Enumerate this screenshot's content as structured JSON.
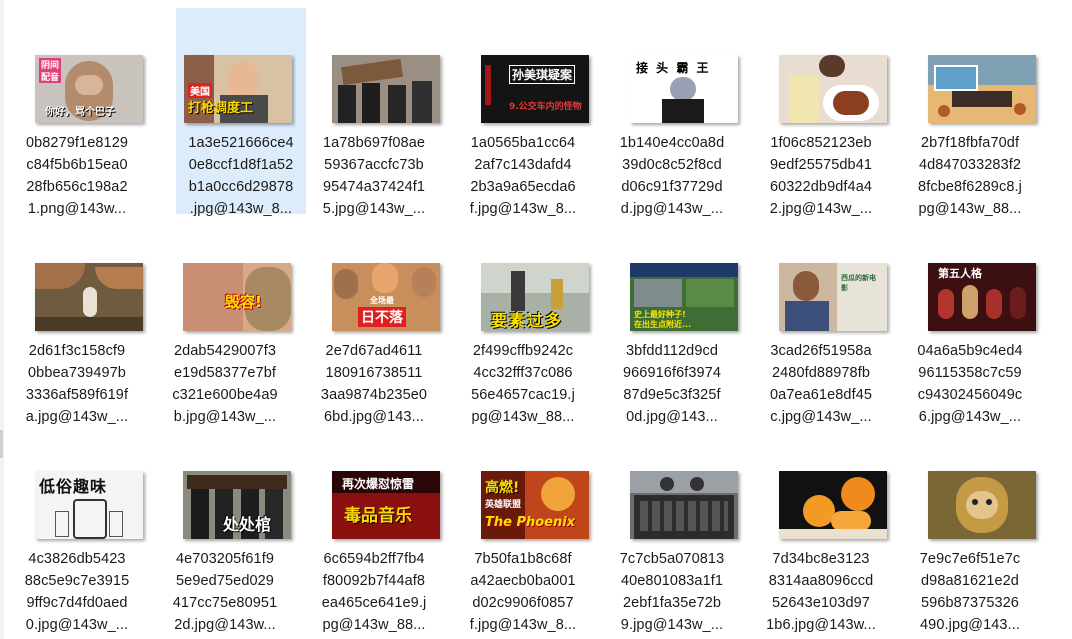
{
  "files": [
    {
      "name": "0b8279f1e8129c84f5b6b15ea028fb656c198a21.png@143w_...",
      "lines": [
        "0b8279f1e8129",
        "c84f5b6b15ea0",
        "28fb656c198a2",
        "1.png@143w..."
      ],
      "thumb_text": [
        "阴间",
        "配音",
        "你好，骂个巴子"
      ],
      "icon": "cat-doll-image",
      "selected": false
    },
    {
      "name": "1a3e521666ce40e8ccf1d8f1a52b1a0cc6d29878.jpg@143w_8...",
      "lines": [
        "1a3e521666ce4",
        "0e8ccf1d8f1a52",
        "b1a0cc6d29878",
        ".jpg@143w_8..."
      ],
      "thumb_text": [
        "美国",
        "打枪调度工"
      ],
      "icon": "man-portrait-image",
      "selected": true
    },
    {
      "name": "1a78b697f08ae59367accfc73b95474a37424f15.jpg@143w_...",
      "lines": [
        "1a78b697f08ae",
        "59367accfc73b",
        "95474a37424f1",
        "5.jpg@143w_..."
      ],
      "thumb_text": [],
      "icon": "coffin-dance-image",
      "selected": false
    },
    {
      "name": "1a0565ba1cc642af7c143dafd42b3a9a65ecda6f.jpg@143w_8...",
      "lines": [
        "1a0565ba1cc64",
        "2af7c143dafd4",
        "2b3a9a65ecda6",
        "f.jpg@143w_8..."
      ],
      "thumb_text": [
        "孙美琪疑案",
        "9.公交车内的怪物"
      ],
      "icon": "dark-title-image",
      "selected": false
    },
    {
      "name": "1b140e4cc0a8d39d0c8c52f8cdd06c91f37729dd.jpg@143w_...",
      "lines": [
        "1b140e4cc0a8d",
        "39d0c8c52f8cd",
        "d06c91f37729d",
        "d.jpg@143w_..."
      ],
      "thumb_text": [
        "接 头 霸 王"
      ],
      "icon": "cat-girl-image",
      "selected": false
    },
    {
      "name": "1f06c852123eb9edf25575db4160322db9df4a42.jpg@143w_...",
      "lines": [
        "1f06c852123eb",
        "9edf25575db41",
        "60322db9df4a4",
        "2.jpg@143w_..."
      ],
      "thumb_text": [],
      "icon": "food-plate-image",
      "selected": false
    },
    {
      "name": "2b7f18fbfa70df4d847033283f28fcbe8f6289c8.jpg@143w_88...",
      "lines": [
        "2b7f18fbfa70df",
        "4d847033283f2",
        "8fcbe8f6289c8.j",
        "pg@143w_88..."
      ],
      "thumb_text": [],
      "icon": "cartoon-room-image",
      "selected": false
    },
    {
      "name": "2d61f3c158cf90bbea739497b3336af589f619fa.jpg@143w_...",
      "lines": [
        "2d61f3c158cf9",
        "0bbea739497b",
        "3336af589f619f",
        "a.jpg@143w_..."
      ],
      "thumb_text": [],
      "icon": "mushroom-forest-image",
      "selected": false
    },
    {
      "name": "2dab5429007f3e19d58377e7bfc321e600be4a9b.jpg@143w_...",
      "lines": [
        "2dab5429007f3",
        "e19d58377e7bf",
        "c321e600be4a9",
        "b.jpg@143w_..."
      ],
      "thumb_text": [
        "毁容!"
      ],
      "icon": "face-cat-image",
      "selected": false
    },
    {
      "name": "2e7d67ad4611180916738511 3aa9874b235e06bd.jpg@143...",
      "lines": [
        "2e7d67ad4611",
        "180916738511",
        "3aa9874b235e0",
        "6bd.jpg@143..."
      ],
      "thumb_text": [
        "全场最",
        "日不落"
      ],
      "icon": "group-faces-image",
      "selected": false
    },
    {
      "name": "2f499cffb9242c4cc32fff37c08656e4657cac19.jpg@143w_88...",
      "lines": [
        "2f499cffb9242c",
        "4cc32fff37c086",
        "56e4657cac19.j",
        "pg@143w_88..."
      ],
      "thumb_text": [
        "要素过多"
      ],
      "icon": "street-scene-image",
      "selected": false
    },
    {
      "name": "3bfdd112d9cd966916f6f397487d9e5c3f325f0d.jpg@143...",
      "lines": [
        "3bfdd112d9cd",
        "966916f6f3974",
        "87d9e5c3f325f",
        "0d.jpg@143..."
      ],
      "thumb_text": [
        "史上最好种子!",
        "在出生点附近..."
      ],
      "icon": "game-seed-image",
      "selected": false
    },
    {
      "name": "3cad26f51958a2480fd88978fb0a7ea61e8df45c.jpg@143w_...",
      "lines": [
        "3cad26f51958a",
        "2480fd88978fb",
        "0a7ea61e8df45",
        "c.jpg@143w_..."
      ],
      "thumb_text": [
        "西瓜的新电",
        "影"
      ],
      "icon": "boy-phone-image",
      "selected": false
    },
    {
      "name": "04a6a5b9c4ed496115358c7c59c94302456049c6.jpg@143w_...",
      "lines": [
        "04a6a5b9c4ed4",
        "96115358c7c59",
        "c94302456049c",
        "6.jpg@143w_..."
      ],
      "thumb_text": [
        "第五人格"
      ],
      "icon": "game-poster-image",
      "selected": false
    },
    {
      "name": "4c3826db542388c5e9c7e39159ff9c7d4fd0aed0.jpg@143w_...",
      "lines": [
        "4c3826db5423",
        "88c5e9c7e3915",
        "9ff9c7d4fd0aed",
        "0.jpg@143w_..."
      ],
      "thumb_text": [
        "低俗趣味"
      ],
      "icon": "sketch-title-image",
      "selected": false
    },
    {
      "name": "4e703205f61f95e9ed75ed029417cc75e809512d.jpg@143w...",
      "lines": [
        "4e703205f61f9",
        "5e9ed75ed029",
        "417cc75e80951",
        "2d.jpg@143w..."
      ],
      "thumb_text": [
        "处处棺"
      ],
      "icon": "coffin-dancers-image",
      "selected": false
    },
    {
      "name": "6c6594b2ff7fb4f80092b7f44af8ea465ce641e9.jpg@143w_88...",
      "lines": [
        "6c6594b2ff7fb4",
        "f80092b7f44af8",
        "ea465ce641e9.j",
        "pg@143w_88..."
      ],
      "thumb_text": [
        "再次爆怼惊雷",
        "毒品音乐"
      ],
      "icon": "music-title-image",
      "selected": false
    },
    {
      "name": "7b50fa1b8c68fa42aecb0ba001d02c9906f0857f.jpg@143w_8...",
      "lines": [
        "7b50fa1b8c68f",
        "a42aecb0ba001",
        "d02c9906f0857",
        "f.jpg@143w_8..."
      ],
      "thumb_text": [
        "高燃!",
        "英雄联盟",
        "The Phoenix"
      ],
      "icon": "phoenix-poster-image",
      "selected": false
    },
    {
      "name": "7c7cb5a07081340e801083a1f12ebf1fa35e72b9.jpg@143w_...",
      "lines": [
        "7c7cb5a070813",
        "40e801083a1f1",
        "2ebf1fa35e72b",
        "9.jpg@143w_..."
      ],
      "thumb_text": [],
      "icon": "calculator-image",
      "selected": false
    },
    {
      "name": "7d34bc8e31238314aa8096ccd52643e103d971b6.jpg@143w...",
      "lines": [
        "7d34bc8e3123",
        "8314aa8096ccd",
        "52643e103d97",
        "1b6.jpg@143w..."
      ],
      "thumb_text": [],
      "icon": "oranges-image",
      "selected": false
    },
    {
      "name": "7e9c7e6f51e7cd98a81621e2d596b87375326490.jpg@143...",
      "lines": [
        "7e9c7e6f51e7c",
        "d98a81621e2d",
        "596b87375326",
        "490.jpg@143..."
      ],
      "thumb_text": [],
      "icon": "monkey-king-image",
      "selected": false
    }
  ]
}
